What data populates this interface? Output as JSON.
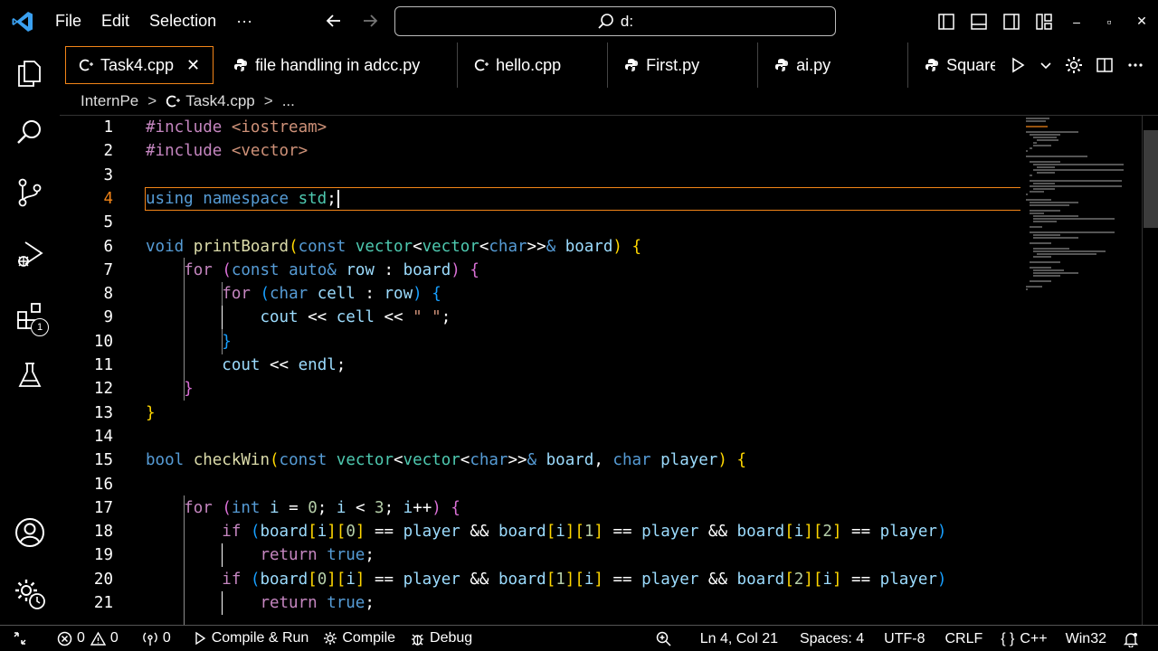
{
  "menu": {
    "file": "File",
    "edit": "Edit",
    "selection": "Selection",
    "more": "···"
  },
  "search": {
    "value": "d:"
  },
  "window": {
    "minimize": "–",
    "maximize": "▫",
    "close": "✕"
  },
  "activity": {
    "extensions_badge": "1"
  },
  "tabs": [
    {
      "label": "Task4.cpp",
      "icon": "cpp-icon",
      "active": true
    },
    {
      "label": "file handling in adcc.py",
      "icon": "python-icon"
    },
    {
      "label": "hello.cpp",
      "icon": "cpp-icon"
    },
    {
      "label": "First.py",
      "icon": "python-icon"
    },
    {
      "label": "ai.py",
      "icon": "python-icon"
    },
    {
      "label": "Square.",
      "icon": "python-icon"
    }
  ],
  "breadcrumb": {
    "folder": "InternPe",
    "file": "Task4.cpp",
    "more": "..."
  },
  "editor": {
    "line_numbers": [
      "1",
      "2",
      "3",
      "4",
      "5",
      "6",
      "7",
      "8",
      "9",
      "10",
      "11",
      "12",
      "13",
      "14",
      "15",
      "16",
      "17",
      "18",
      "19",
      "20",
      "21"
    ],
    "current_line": 4
  },
  "status": {
    "errors": "0",
    "warnings": "0",
    "ports": "0",
    "compile_run": "Compile & Run",
    "compile": "Compile",
    "debug": "Debug",
    "position": "Ln 4, Col 21",
    "spaces": "Spaces: 4",
    "encoding": "UTF-8",
    "eol": "CRLF",
    "language": "C++",
    "platform": "Win32"
  },
  "colors": {
    "accent": "#f38518",
    "keyword": "#569cd6",
    "control": "#c586c0",
    "function": "#dcdcaa",
    "type": "#4ec9b0",
    "string": "#ce9178",
    "number": "#b5cea8"
  }
}
